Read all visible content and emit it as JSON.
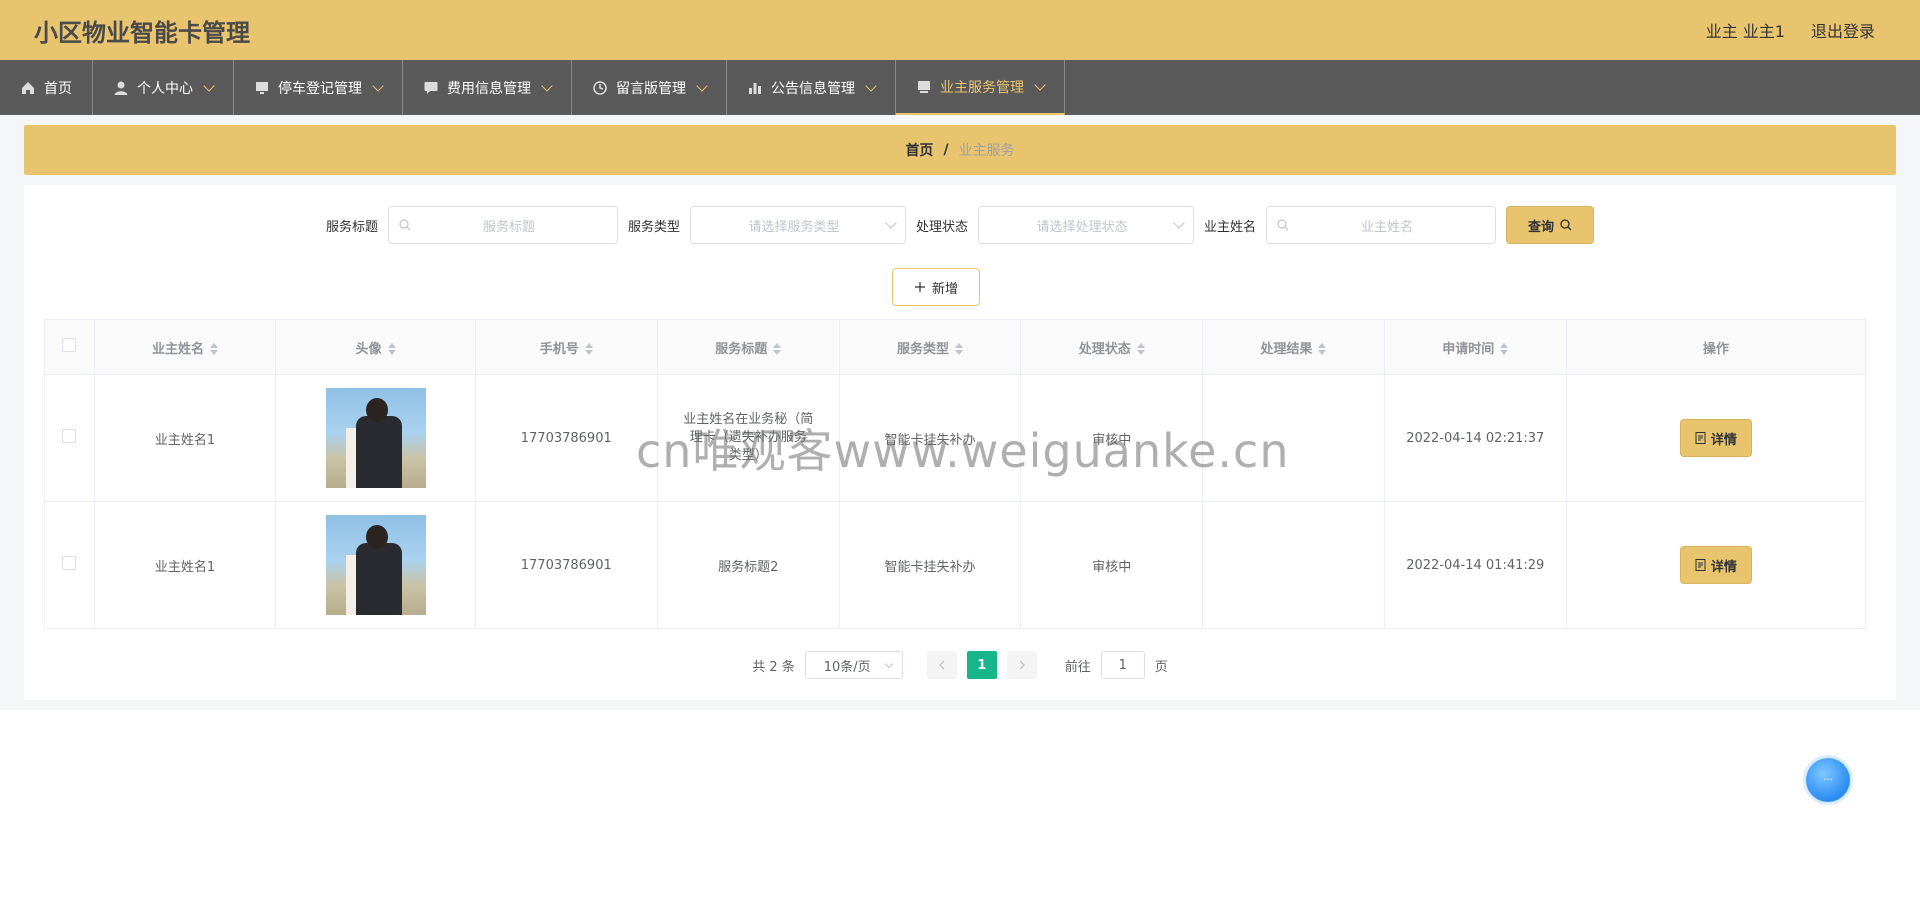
{
  "app": {
    "title": "小区物业智能卡管理"
  },
  "header": {
    "user": "业主 业主1",
    "logout": "退出登录"
  },
  "nav": [
    {
      "label": "首页",
      "icon": "home-icon"
    },
    {
      "label": "个人中心",
      "icon": "user-icon"
    },
    {
      "label": "停车登记管理",
      "icon": "monitor-icon"
    },
    {
      "label": "费用信息管理",
      "icon": "chat-icon"
    },
    {
      "label": "留言版管理",
      "icon": "clock-icon"
    },
    {
      "label": "公告信息管理",
      "icon": "bar-chart-icon"
    },
    {
      "label": "业主服务管理",
      "icon": "desktop-icon",
      "active": true
    }
  ],
  "breadcrumb": {
    "home": "首页",
    "separator": "/",
    "current": "业主服务"
  },
  "search": {
    "title_label": "服务标题",
    "title_placeholder": "服务标题",
    "type_label": "服务类型",
    "type_placeholder": "请选择服务类型",
    "status_label": "处理状态",
    "status_placeholder": "请选择处理状态",
    "name_label": "业主姓名",
    "name_placeholder": "业主姓名",
    "button": "查询"
  },
  "add_button": "新增",
  "table": {
    "columns": [
      "业主姓名",
      "头像",
      "手机号",
      "服务标题",
      "服务类型",
      "处理状态",
      "处理结果",
      "申请时间",
      "操作"
    ],
    "rows": [
      {
        "name": "业主姓名1",
        "phone": "17703786901",
        "title": "业主姓名在业务秘（简\n理卡（遗失补办服务\n类型）",
        "type": "智能卡挂失补办",
        "status": "审核中",
        "result": "",
        "time": "2022-04-14 02:21:37",
        "action": "详情"
      },
      {
        "name": "业主姓名1",
        "phone": "17703786901",
        "title": "服务标题2",
        "type": "智能卡挂失补办",
        "status": "审核中",
        "result": "",
        "time": "2022-04-14 01:41:29",
        "action": "详情"
      }
    ]
  },
  "pagination": {
    "total": "共 2 条",
    "page_size": "10条/页",
    "current_page": "1",
    "goto_prefix": "前往",
    "goto_value": "1",
    "goto_suffix": "页"
  },
  "watermark": "cn唯观客www.weiguanke.cn",
  "float_button": "···"
}
